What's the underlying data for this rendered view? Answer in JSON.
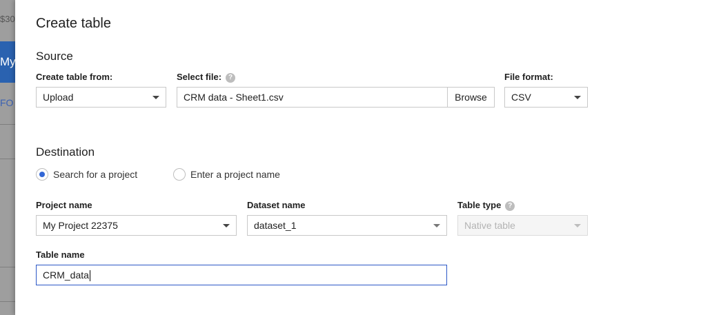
{
  "background": {
    "price_text": "$30",
    "tab_text": "My",
    "fo_text": "FO"
  },
  "dialog": {
    "title": "Create table",
    "source": {
      "heading": "Source",
      "create_from_label": "Create table from:",
      "create_from_value": "Upload",
      "select_file_label": "Select file:",
      "select_file_value": "CRM data - Sheet1.csv",
      "browse_label": "Browse",
      "file_format_label": "File format:",
      "file_format_value": "CSV"
    },
    "destination": {
      "heading": "Destination",
      "radio_search_label": "Search for a project",
      "radio_enter_label": "Enter a project name",
      "selected_radio": "search",
      "project_name_label": "Project name",
      "project_name_value": "My Project 22375",
      "dataset_name_label": "Dataset name",
      "dataset_name_value": "dataset_1",
      "table_type_label": "Table type",
      "table_type_value": "Native table",
      "table_name_label": "Table name",
      "table_name_value": "CRM_data"
    },
    "help_icon_glyph": "?"
  },
  "colors": {
    "accent_blue": "#3367d6",
    "focus_border": "#2a56c6",
    "overlay_gray": "#9e9e9e"
  }
}
